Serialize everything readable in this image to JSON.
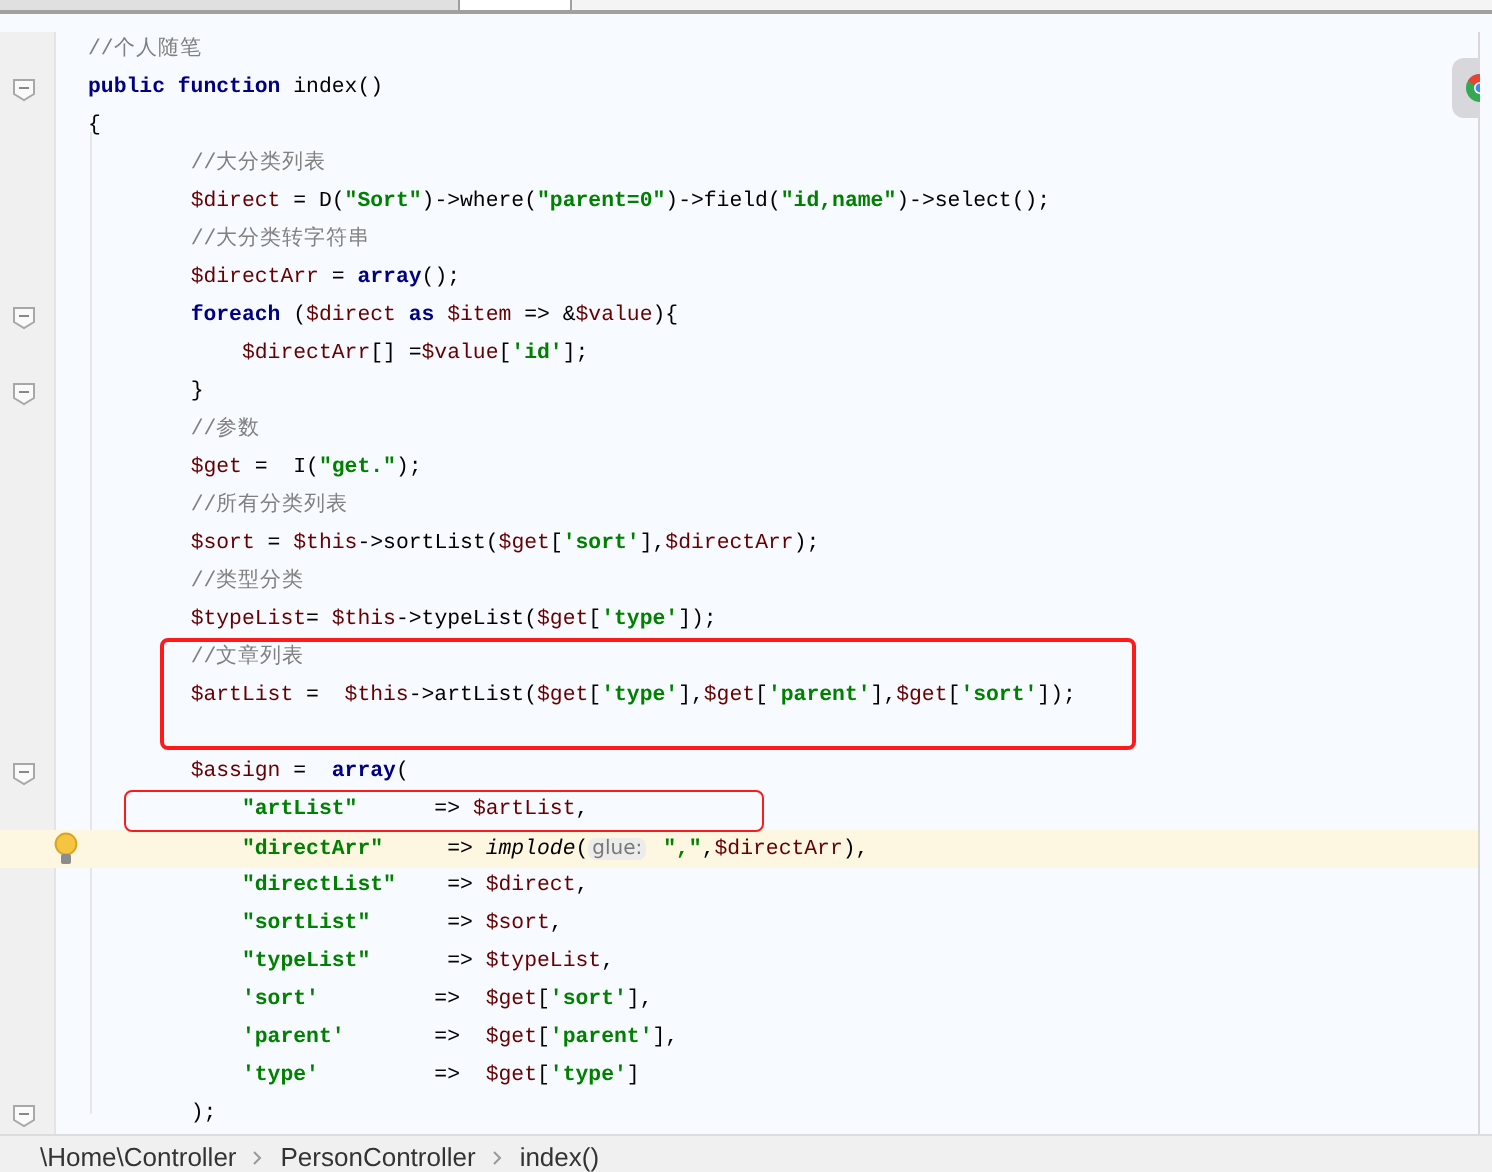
{
  "code_lines": [
    {
      "fold": false,
      "current": false,
      "tokens": [
        {
          "kind": "comment",
          "text": "//个人随笔"
        }
      ]
    },
    {
      "fold": true,
      "current": false,
      "tokens": [
        {
          "kind": "keyword",
          "text": "public function "
        },
        {
          "kind": "plain",
          "text": "index()"
        }
      ]
    },
    {
      "fold": false,
      "current": false,
      "tokens": [
        {
          "kind": "plain",
          "text": "{"
        }
      ]
    },
    {
      "fold": false,
      "current": false,
      "tokens": [
        {
          "kind": "comment",
          "text": "        //大分类列表"
        }
      ]
    },
    {
      "fold": false,
      "current": false,
      "tokens": [
        {
          "kind": "variable",
          "text": "        $direct"
        },
        {
          "kind": "plain",
          "text": " = D("
        },
        {
          "kind": "string",
          "text": "\"Sort\""
        },
        {
          "kind": "plain",
          "text": ")->where("
        },
        {
          "kind": "string",
          "text": "\"parent=0\""
        },
        {
          "kind": "plain",
          "text": ")->field("
        },
        {
          "kind": "string",
          "text": "\"id,name\""
        },
        {
          "kind": "plain",
          "text": ")->select();"
        }
      ]
    },
    {
      "fold": false,
      "current": false,
      "tokens": [
        {
          "kind": "comment",
          "text": "        //大分类转字符串"
        }
      ]
    },
    {
      "fold": false,
      "current": false,
      "tokens": [
        {
          "kind": "variable",
          "text": "        $directArr"
        },
        {
          "kind": "plain",
          "text": " = "
        },
        {
          "kind": "keyword",
          "text": "array"
        },
        {
          "kind": "plain",
          "text": "();"
        }
      ]
    },
    {
      "fold": true,
      "current": false,
      "tokens": [
        {
          "kind": "keyword",
          "text": "        foreach"
        },
        {
          "kind": "plain",
          "text": " ("
        },
        {
          "kind": "variable",
          "text": "$direct"
        },
        {
          "kind": "keyword",
          "text": " as "
        },
        {
          "kind": "variable",
          "text": "$item"
        },
        {
          "kind": "plain",
          "text": " => &"
        },
        {
          "kind": "variable",
          "text": "$value"
        },
        {
          "kind": "plain",
          "text": "){"
        }
      ]
    },
    {
      "fold": false,
      "current": false,
      "tokens": [
        {
          "kind": "variable",
          "text": "            $directArr"
        },
        {
          "kind": "plain",
          "text": "[] ="
        },
        {
          "kind": "variable",
          "text": "$value"
        },
        {
          "kind": "plain",
          "text": "["
        },
        {
          "kind": "string",
          "text": "'id'"
        },
        {
          "kind": "plain",
          "text": "];"
        }
      ]
    },
    {
      "fold": true,
      "current": false,
      "tokens": [
        {
          "kind": "plain",
          "text": "        }"
        }
      ]
    },
    {
      "fold": false,
      "current": false,
      "tokens": [
        {
          "kind": "comment",
          "text": "        //参数"
        }
      ]
    },
    {
      "fold": false,
      "current": false,
      "tokens": [
        {
          "kind": "variable",
          "text": "        $get"
        },
        {
          "kind": "plain",
          "text": " =  I("
        },
        {
          "kind": "string",
          "text": "\"get.\""
        },
        {
          "kind": "plain",
          "text": ");"
        }
      ]
    },
    {
      "fold": false,
      "current": false,
      "tokens": [
        {
          "kind": "comment",
          "text": "        //所有分类列表"
        }
      ]
    },
    {
      "fold": false,
      "current": false,
      "tokens": [
        {
          "kind": "variable",
          "text": "        $sort"
        },
        {
          "kind": "plain",
          "text": " = "
        },
        {
          "kind": "variable",
          "text": "$this"
        },
        {
          "kind": "plain",
          "text": "->sortList("
        },
        {
          "kind": "variable",
          "text": "$get"
        },
        {
          "kind": "plain",
          "text": "["
        },
        {
          "kind": "string",
          "text": "'sort'"
        },
        {
          "kind": "plain",
          "text": "],"
        },
        {
          "kind": "variable",
          "text": "$directArr"
        },
        {
          "kind": "plain",
          "text": ");"
        }
      ]
    },
    {
      "fold": false,
      "current": false,
      "tokens": [
        {
          "kind": "comment",
          "text": "        //类型分类"
        }
      ]
    },
    {
      "fold": false,
      "current": false,
      "tokens": [
        {
          "kind": "variable",
          "text": "        $typeList"
        },
        {
          "kind": "plain",
          "text": "= "
        },
        {
          "kind": "variable",
          "text": "$this"
        },
        {
          "kind": "plain",
          "text": "->typeList("
        },
        {
          "kind": "variable",
          "text": "$get"
        },
        {
          "kind": "plain",
          "text": "["
        },
        {
          "kind": "string",
          "text": "'type'"
        },
        {
          "kind": "plain",
          "text": "]);"
        }
      ]
    },
    {
      "fold": false,
      "current": false,
      "tokens": [
        {
          "kind": "comment",
          "text": "        //文章列表"
        }
      ]
    },
    {
      "fold": false,
      "current": false,
      "tokens": [
        {
          "kind": "variable",
          "text": "        $artList"
        },
        {
          "kind": "plain",
          "text": " =  "
        },
        {
          "kind": "variable",
          "text": "$this"
        },
        {
          "kind": "plain",
          "text": "->artList("
        },
        {
          "kind": "variable",
          "text": "$get"
        },
        {
          "kind": "plain",
          "text": "["
        },
        {
          "kind": "string",
          "text": "'type'"
        },
        {
          "kind": "plain",
          "text": "],"
        },
        {
          "kind": "variable",
          "text": "$get"
        },
        {
          "kind": "plain",
          "text": "["
        },
        {
          "kind": "string",
          "text": "'parent'"
        },
        {
          "kind": "plain",
          "text": "],"
        },
        {
          "kind": "variable",
          "text": "$get"
        },
        {
          "kind": "plain",
          "text": "["
        },
        {
          "kind": "string",
          "text": "'sort'"
        },
        {
          "kind": "plain",
          "text": "]);"
        }
      ]
    },
    {
      "fold": false,
      "current": false
    },
    {
      "fold": true,
      "current": false,
      "tokens": [
        {
          "kind": "variable",
          "text": "        $assign"
        },
        {
          "kind": "plain",
          "text": " =  "
        },
        {
          "kind": "keyword",
          "text": "array"
        },
        {
          "kind": "plain",
          "text": "("
        }
      ]
    },
    {
      "fold": false,
      "current": false,
      "tokens": [
        {
          "kind": "string",
          "text": "            \"artList\""
        },
        {
          "kind": "plain",
          "text": "      => "
        },
        {
          "kind": "variable",
          "text": "$artList"
        },
        {
          "kind": "plain",
          "text": ","
        }
      ]
    },
    {
      "fold": false,
      "current": true,
      "tokens": [
        {
          "kind": "string",
          "text": "            \"directArr\""
        },
        {
          "kind": "plain",
          "text": "     => "
        },
        {
          "kind": "function",
          "text": "implode"
        },
        {
          "kind": "plain",
          "text": "("
        },
        {
          "kind": "hint",
          "text": "glue:"
        },
        {
          "kind": "string",
          "text": " \",\""
        },
        {
          "kind": "plain",
          "text": ","
        },
        {
          "kind": "variable",
          "text": "$directArr"
        },
        {
          "kind": "plain",
          "text": "),"
        }
      ]
    },
    {
      "fold": false,
      "current": false,
      "tokens": [
        {
          "kind": "string",
          "text": "            \"directList\""
        },
        {
          "kind": "plain",
          "text": "    => "
        },
        {
          "kind": "variable",
          "text": "$direct"
        },
        {
          "kind": "plain",
          "text": ","
        }
      ]
    },
    {
      "fold": false,
      "current": false,
      "tokens": [
        {
          "kind": "string",
          "text": "            \"sortList\""
        },
        {
          "kind": "plain",
          "text": "      => "
        },
        {
          "kind": "variable",
          "text": "$sort"
        },
        {
          "kind": "plain",
          "text": ","
        }
      ]
    },
    {
      "fold": false,
      "current": false,
      "tokens": [
        {
          "kind": "string",
          "text": "            \"typeList\""
        },
        {
          "kind": "plain",
          "text": "      => "
        },
        {
          "kind": "variable",
          "text": "$typeList"
        },
        {
          "kind": "plain",
          "text": ","
        }
      ]
    },
    {
      "fold": false,
      "current": false,
      "tokens": [
        {
          "kind": "string",
          "text": "            'sort'"
        },
        {
          "kind": "plain",
          "text": "         =>  "
        },
        {
          "kind": "variable",
          "text": "$get"
        },
        {
          "kind": "plain",
          "text": "["
        },
        {
          "kind": "string",
          "text": "'sort'"
        },
        {
          "kind": "plain",
          "text": "],"
        }
      ]
    },
    {
      "fold": false,
      "current": false,
      "tokens": [
        {
          "kind": "string",
          "text": "            'parent'"
        },
        {
          "kind": "plain",
          "text": "       =>  "
        },
        {
          "kind": "variable",
          "text": "$get"
        },
        {
          "kind": "plain",
          "text": "["
        },
        {
          "kind": "string",
          "text": "'parent'"
        },
        {
          "kind": "plain",
          "text": "],"
        }
      ]
    },
    {
      "fold": false,
      "current": false,
      "tokens": [
        {
          "kind": "string",
          "text": "            'type'"
        },
        {
          "kind": "plain",
          "text": "         =>  "
        },
        {
          "kind": "variable",
          "text": "$get"
        },
        {
          "kind": "plain",
          "text": "["
        },
        {
          "kind": "string",
          "text": "'type'"
        },
        {
          "kind": "plain",
          "text": "]"
        }
      ]
    },
    {
      "fold": true,
      "current": false,
      "tokens": [
        {
          "kind": "plain",
          "text": "        );"
        }
      ]
    }
  ],
  "breadcrumbs": [
    "\\Home\\Controller",
    "PersonController",
    "index()"
  ]
}
